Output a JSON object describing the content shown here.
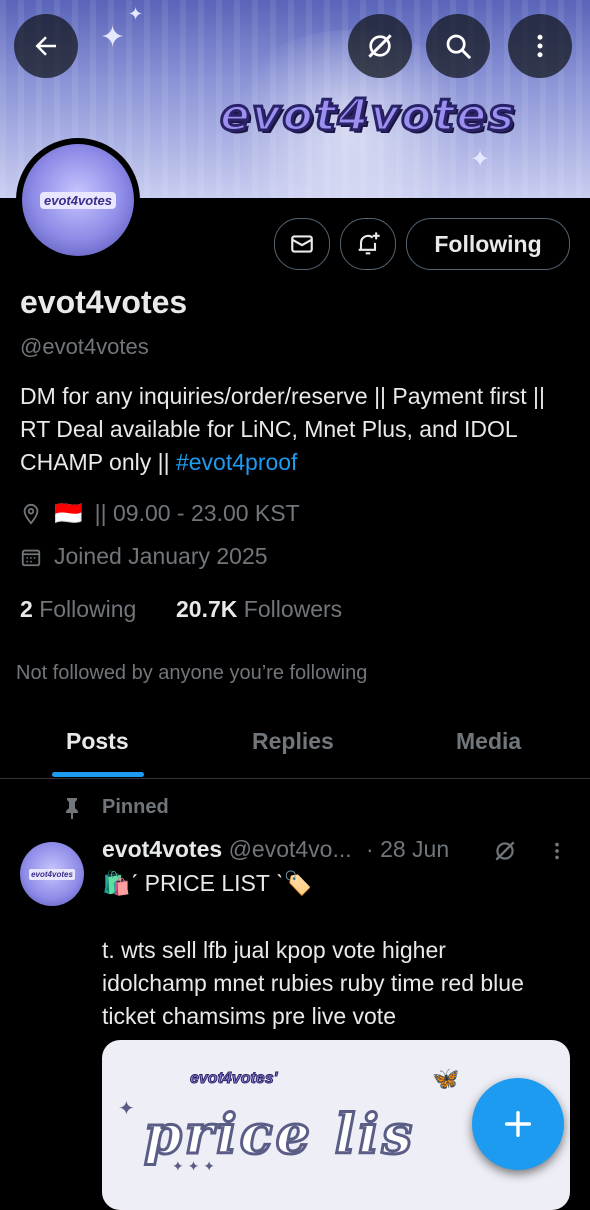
{
  "banner": {
    "logo_text": "evot4votes"
  },
  "avatar": {
    "text": "evot4votes"
  },
  "header_actions": {
    "following_label": "Following"
  },
  "profile": {
    "name": "evot4votes",
    "handle": "@evot4votes",
    "bio_text": "DM for any inquiries/order/reserve  ||  Payment first ||  RT Deal available for LiNC, Mnet Plus, and IDOL CHAMP only  || ",
    "bio_link": "#evot4proof",
    "location_flag": "🇮🇩",
    "location_text": "|| 09.00 - 23.00 KST",
    "joined": "Joined January 2025"
  },
  "stats": {
    "following_count": "2",
    "following_label": "Following",
    "followers_count": "20.7K",
    "followers_label": "Followers"
  },
  "social_context": "Not followed by anyone you’re following",
  "tabs": [
    {
      "label": "Posts"
    },
    {
      "label": "Replies"
    },
    {
      "label": "Media"
    }
  ],
  "post": {
    "pinned_label": "Pinned",
    "author_name": "evot4votes",
    "author_handle": "@evot4vo...",
    "date": "· 28 Jun",
    "avatar_text": "evot4votes",
    "headline": "🛍️ˊ PRICE LIST ˋ🏷️",
    "body": "t. wts sell lfb jual kpop vote higher idolchamp mnet rubies ruby time red blue ticket chamsims pre live vote",
    "card_sub": "evot4votes'",
    "card_title": "price lis"
  },
  "colors": {
    "accent": "#1d9bf0",
    "muted": "#71767b",
    "text": "#e7e9ea",
    "background": "#000000"
  }
}
